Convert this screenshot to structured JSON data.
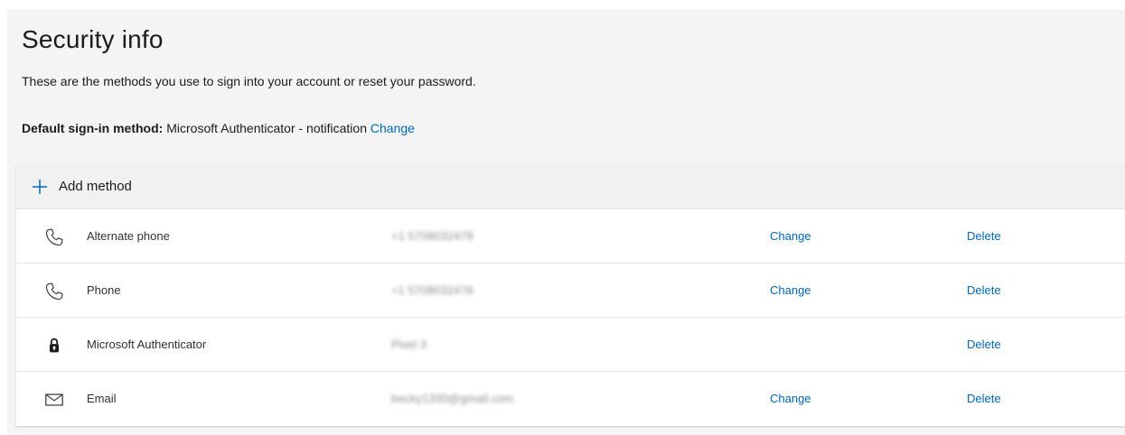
{
  "page": {
    "title": "Security info",
    "subtitle": "These are the methods you use to sign into your account or reset your password.",
    "default_label": "Default sign-in method:",
    "default_value": " Microsoft Authenticator - notification ",
    "default_change": "Change"
  },
  "add_method": {
    "label": "Add method",
    "icon": "plus-icon"
  },
  "methods": [
    {
      "name": "Alternate phone",
      "value": "+1 5708032478",
      "change": "Change",
      "delete": "Delete",
      "icon": "phone-icon"
    },
    {
      "name": "Phone",
      "value": "+1 5708032478",
      "change": "Change",
      "delete": "Delete",
      "icon": "phone-icon"
    },
    {
      "name": "Microsoft Authenticator",
      "value": "Pixel 3",
      "change": "",
      "delete": "Delete",
      "icon": "lock-icon"
    },
    {
      "name": "Email",
      "value": "becky1330@gmail.com",
      "change": "Change",
      "delete": "Delete",
      "icon": "mail-icon"
    }
  ],
  "colors": {
    "link": "#0067b8",
    "background": "#f4f4f4",
    "card": "#ffffff"
  }
}
